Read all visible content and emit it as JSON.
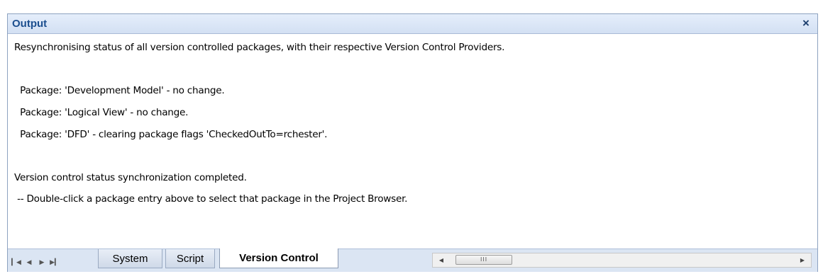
{
  "panel": {
    "title": "Output",
    "close_icon": "×"
  },
  "output_lines": [
    "Resynchronising status of all version controlled packages, with their respective Version Control Providers.",
    "  Package: 'Development Model' - no change.",
    "  Package: 'Logical View' - no change.",
    "  Package: 'DFD' - clearing package flags 'CheckedOutTo=rchester'.",
    "Version control status synchronization completed.",
    " -- Double-click a package entry above to select that package in the Project Browser."
  ],
  "tabs": {
    "nav_icons": {
      "first": "▎◀",
      "prev": "◀",
      "next": "▶",
      "last": "▶▎"
    },
    "items": [
      {
        "label": "System"
      },
      {
        "label": "Script"
      },
      {
        "label": "Version Control"
      }
    ],
    "active": "Version Control"
  },
  "scrollbar": {
    "left_arrow": "◀",
    "right_arrow": "▶",
    "grip": "III"
  },
  "colors": {
    "title_text": "#1c4f8f",
    "titlebar_bg": "#dbe6f5",
    "tabbar_bg": "#dbe5f3"
  }
}
